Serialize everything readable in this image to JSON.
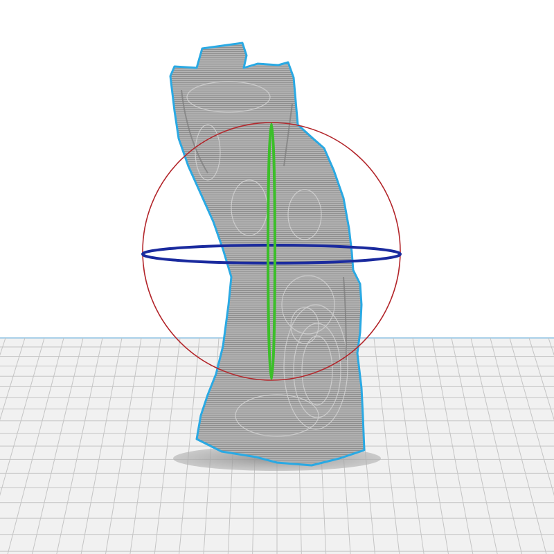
{
  "viewport": {
    "background_color": "#ffffff",
    "build_plate": {
      "grid": true,
      "plate_color": "#f1f1f1",
      "grid_line_color": "#c4c4c4",
      "edge_color": "#8fc3e3"
    },
    "model": {
      "fill_color": "#b2b2b2",
      "layer_line_color": "#8a8a8a",
      "highlight_color": "#d6d6d6",
      "outline_color": "#2aa9e3",
      "shadow_color": "#999999",
      "selected": true
    },
    "rotate_gizmo": {
      "visible": true,
      "x_ring_color": "#b3262b",
      "y_ring_color": "#1a2a9e",
      "z_ring_color": "#3cbf2a"
    }
  }
}
